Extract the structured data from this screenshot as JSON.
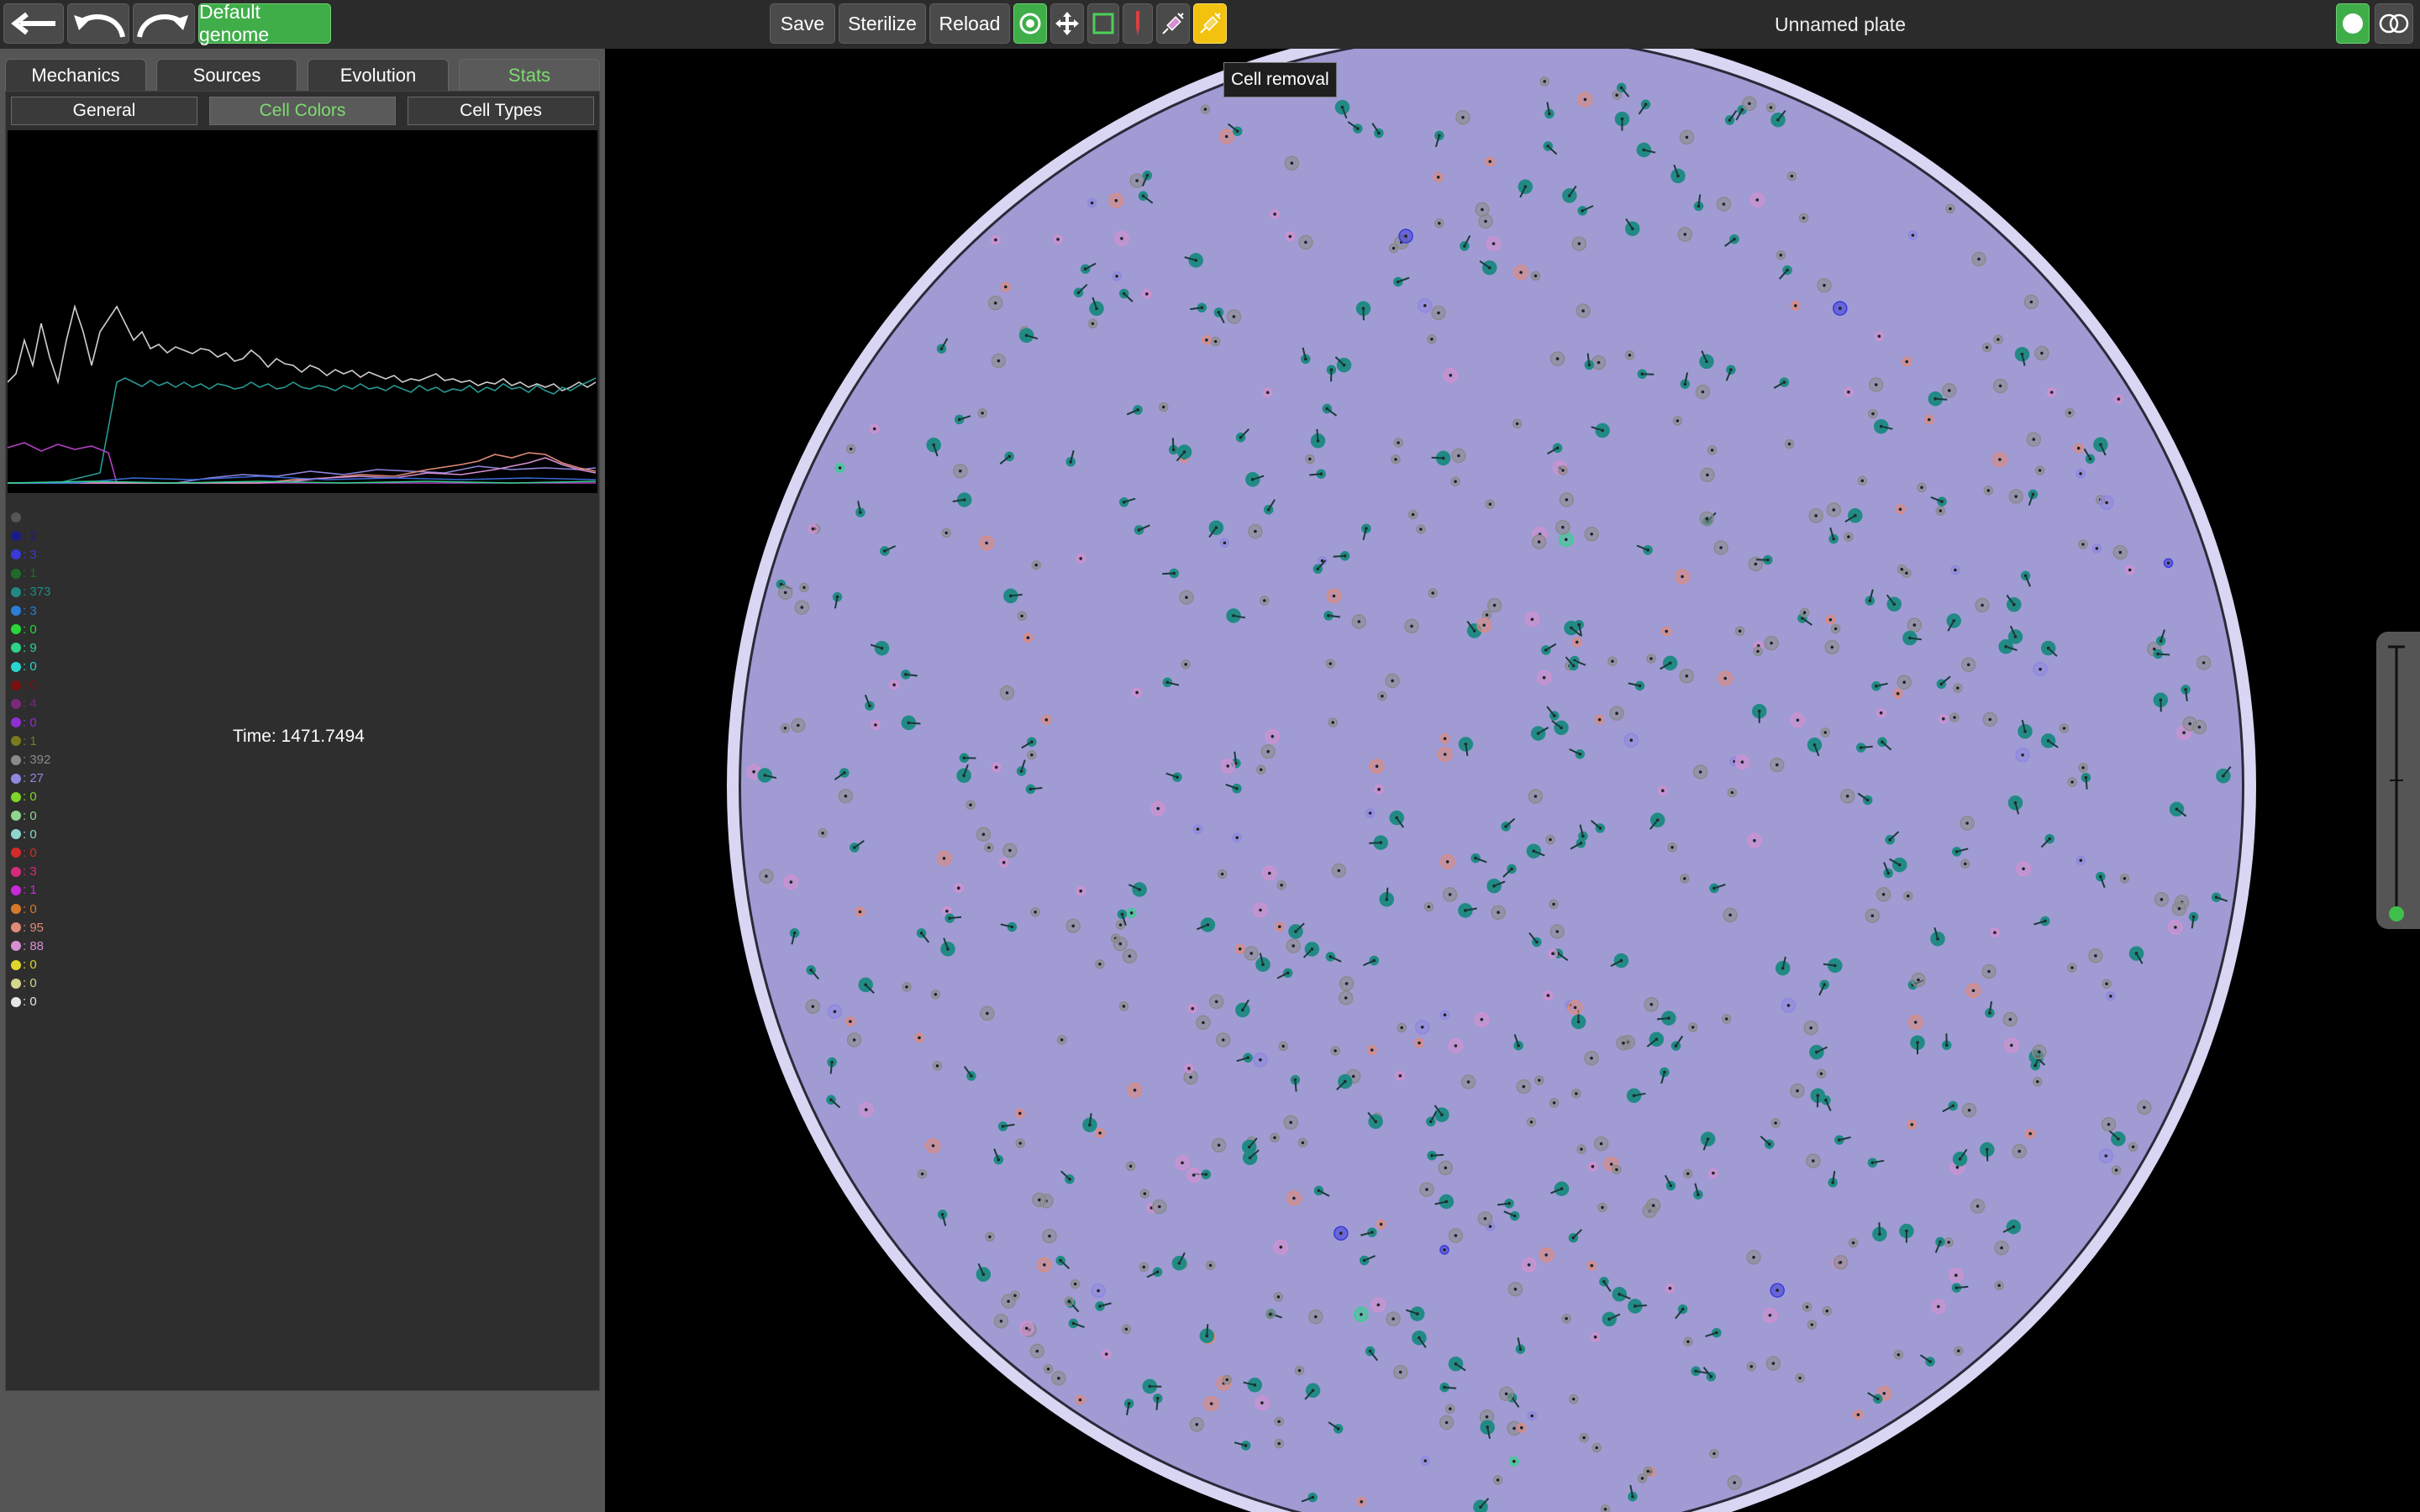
{
  "toolbar": {
    "back_icon": "arrow-left-icon",
    "undo_icon": "undo-icon",
    "redo_icon": "redo-icon",
    "genome_label": "Default genome",
    "save_label": "Save",
    "sterilize_label": "Sterilize",
    "reload_label": "Reload",
    "tools": [
      "cell-add-icon",
      "move-icon",
      "select-rect-icon",
      "knife-icon",
      "syringe-icon",
      "cell-removal-icon"
    ],
    "active_tool": "cell-removal-icon",
    "plate_title": "Unnamed plate",
    "right_buttons": [
      "circle-toggle-icon",
      "view-mode-icon"
    ]
  },
  "tooltip": {
    "text": "Cell removal"
  },
  "left_panel": {
    "tabs": [
      "Mechanics",
      "Sources",
      "Evolution",
      "Stats"
    ],
    "active_tab": "Stats",
    "subtabs": [
      "General",
      "Cell Colors",
      "Cell Types"
    ],
    "active_subtab": "Cell Colors",
    "time_label": "Time: 1471.7494",
    "legend": [
      {
        "color": "#555555",
        "text": ""
      },
      {
        "color": "#1a1a8a",
        "text": ": 2"
      },
      {
        "color": "#3a3ad8",
        "text": ": 3"
      },
      {
        "color": "#1f6b2a",
        "text": ": 1"
      },
      {
        "color": "#218a85",
        "text": ": 373"
      },
      {
        "color": "#2a7fd8",
        "text": ": 3"
      },
      {
        "color": "#27d637",
        "text": ": 0"
      },
      {
        "color": "#2fd38c",
        "text": ": 9"
      },
      {
        "color": "#2ad6d0",
        "text": ": 0"
      },
      {
        "color": "#7a1010",
        "text": ": 0"
      },
      {
        "color": "#7a2a7a",
        "text": ": 4"
      },
      {
        "color": "#8f2fd0",
        "text": ": 0"
      },
      {
        "color": "#7a7a20",
        "text": ": 1"
      },
      {
        "color": "#8a8a8a",
        "text": ": 392"
      },
      {
        "color": "#8f87e0",
        "text": ": 27"
      },
      {
        "color": "#7fd62a",
        "text": ": 0"
      },
      {
        "color": "#8fd68f",
        "text": ": 0"
      },
      {
        "color": "#8fd6d0",
        "text": ": 0"
      },
      {
        "color": "#d62a2a",
        "text": ": 0"
      },
      {
        "color": "#d62a7a",
        "text": ": 3"
      },
      {
        "color": "#c82ad6",
        "text": ": 1"
      },
      {
        "color": "#d67a2a",
        "text": ": 0"
      },
      {
        "color": "#e08a7a",
        "text": ": 95"
      },
      {
        "color": "#d68fd0",
        "text": ": 88"
      },
      {
        "color": "#e0d62a",
        "text": ": 0"
      },
      {
        "color": "#d6d68f",
        "text": ": 0"
      },
      {
        "color": "#e6e6e6",
        "text": ": 0"
      }
    ]
  },
  "colors": {
    "plate_fill": "#a09bd3",
    "plate_rim": "#d9d6f3",
    "accent_green": "#3fae49",
    "accent_yellow": "#f2c20f"
  }
}
